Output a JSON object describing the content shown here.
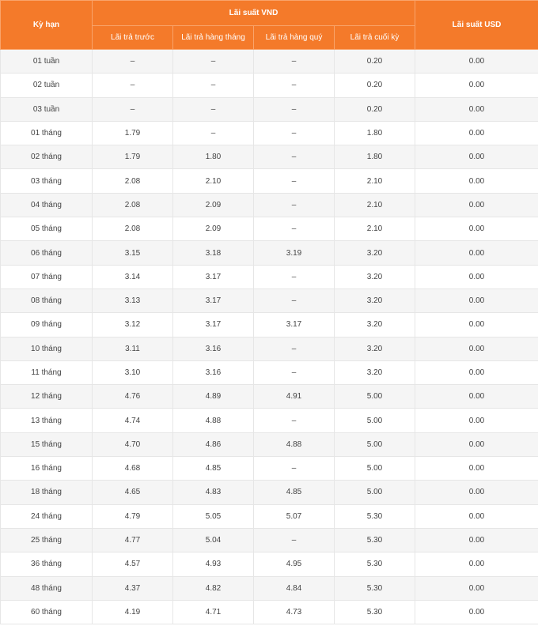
{
  "table": {
    "header": {
      "term": "Kỳ hạn",
      "vnd_group": "Lãi suất VND",
      "usd": "Lãi suất USD",
      "vnd_columns": [
        "Lãi trả trước",
        "Lãi trả hàng tháng",
        "Lãi trả hàng quý",
        "Lãi trả cuối kỳ"
      ]
    },
    "rows": [
      {
        "term": "01 tuần",
        "prepaid": "–",
        "monthly": "–",
        "quarterly": "–",
        "end": "0.20",
        "usd": "0.00"
      },
      {
        "term": "02 tuần",
        "prepaid": "–",
        "monthly": "–",
        "quarterly": "–",
        "end": "0.20",
        "usd": "0.00"
      },
      {
        "term": "03 tuần",
        "prepaid": "–",
        "monthly": "–",
        "quarterly": "–",
        "end": "0.20",
        "usd": "0.00"
      },
      {
        "term": "01 tháng",
        "prepaid": "1.79",
        "monthly": "–",
        "quarterly": "–",
        "end": "1.80",
        "usd": "0.00"
      },
      {
        "term": "02 tháng",
        "prepaid": "1.79",
        "monthly": "1.80",
        "quarterly": "–",
        "end": "1.80",
        "usd": "0.00"
      },
      {
        "term": "03 tháng",
        "prepaid": "2.08",
        "monthly": "2.10",
        "quarterly": "–",
        "end": "2.10",
        "usd": "0.00"
      },
      {
        "term": "04 tháng",
        "prepaid": "2.08",
        "monthly": "2.09",
        "quarterly": "–",
        "end": "2.10",
        "usd": "0.00"
      },
      {
        "term": "05 tháng",
        "prepaid": "2.08",
        "monthly": "2.09",
        "quarterly": "–",
        "end": "2.10",
        "usd": "0.00"
      },
      {
        "term": "06 tháng",
        "prepaid": "3.15",
        "monthly": "3.18",
        "quarterly": "3.19",
        "end": "3.20",
        "usd": "0.00"
      },
      {
        "term": "07 tháng",
        "prepaid": "3.14",
        "monthly": "3.17",
        "quarterly": "–",
        "end": "3.20",
        "usd": "0.00"
      },
      {
        "term": "08 tháng",
        "prepaid": "3.13",
        "monthly": "3.17",
        "quarterly": "–",
        "end": "3.20",
        "usd": "0.00"
      },
      {
        "term": "09 tháng",
        "prepaid": "3.12",
        "monthly": "3.17",
        "quarterly": "3.17",
        "end": "3.20",
        "usd": "0.00"
      },
      {
        "term": "10 tháng",
        "prepaid": "3.11",
        "monthly": "3.16",
        "quarterly": "–",
        "end": "3.20",
        "usd": "0.00"
      },
      {
        "term": "11 tháng",
        "prepaid": "3.10",
        "monthly": "3.16",
        "quarterly": "–",
        "end": "3.20",
        "usd": "0.00"
      },
      {
        "term": "12 tháng",
        "prepaid": "4.76",
        "monthly": "4.89",
        "quarterly": "4.91",
        "end": "5.00",
        "usd": "0.00"
      },
      {
        "term": "13 tháng",
        "prepaid": "4.74",
        "monthly": "4.88",
        "quarterly": "–",
        "end": "5.00",
        "usd": "0.00"
      },
      {
        "term": "15 tháng",
        "prepaid": "4.70",
        "monthly": "4.86",
        "quarterly": "4.88",
        "end": "5.00",
        "usd": "0.00"
      },
      {
        "term": "16 tháng",
        "prepaid": "4.68",
        "monthly": "4.85",
        "quarterly": "–",
        "end": "5.00",
        "usd": "0.00"
      },
      {
        "term": "18 tháng",
        "prepaid": "4.65",
        "monthly": "4.83",
        "quarterly": "4.85",
        "end": "5.00",
        "usd": "0.00"
      },
      {
        "term": "24 tháng",
        "prepaid": "4.79",
        "monthly": "5.05",
        "quarterly": "5.07",
        "end": "5.30",
        "usd": "0.00"
      },
      {
        "term": "25 tháng",
        "prepaid": "4.77",
        "monthly": "5.04",
        "quarterly": "–",
        "end": "5.30",
        "usd": "0.00"
      },
      {
        "term": "36 tháng",
        "prepaid": "4.57",
        "monthly": "4.93",
        "quarterly": "4.95",
        "end": "5.30",
        "usd": "0.00"
      },
      {
        "term": "48 tháng",
        "prepaid": "4.37",
        "monthly": "4.82",
        "quarterly": "4.84",
        "end": "5.30",
        "usd": "0.00"
      },
      {
        "term": "60 tháng",
        "prepaid": "4.19",
        "monthly": "4.71",
        "quarterly": "4.73",
        "end": "5.30",
        "usd": "0.00"
      }
    ]
  }
}
